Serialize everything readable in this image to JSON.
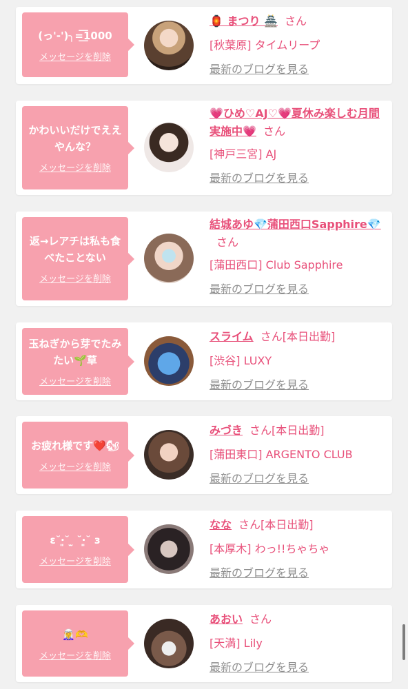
{
  "messages": [
    {
      "bubble_text": "(っ'-')╮=͟͟͞͞1000",
      "delete_label": "メッセージを削除",
      "name": "🏮 まつり 🏯",
      "san": "さん",
      "tag": "",
      "shop": "[秋葉原] タイムリープ",
      "blog_link": "最新のブログを見る"
    },
    {
      "bubble_text": "かわいいだけでええやんな？",
      "delete_label": "メッセージを削除",
      "name": "💗ひめ♡AJ♡💗夏休み楽しむ月間実施中💗",
      "san": "さん",
      "tag": "",
      "shop": "[神戸三宮] AJ",
      "blog_link": "最新のブログを見る"
    },
    {
      "bubble_text": "返→レアチは私も食べたことない",
      "delete_label": "メッセージを削除",
      "name": "結城あゆ💎蒲田西口Sapphire💎",
      "san": "さん",
      "tag": "",
      "shop": "[蒲田西口] Club Sapphire",
      "blog_link": "最新のブログを見る"
    },
    {
      "bubble_text": "玉ねぎから芽でたみたい🌱草",
      "delete_label": "メッセージを削除",
      "name": "スライム",
      "san": "さん",
      "tag": "[本日出勤]",
      "shop": "[渋谷] LUXY",
      "blog_link": "最新のブログを見る"
    },
    {
      "bubble_text": "お疲れ様です❤️🐿",
      "delete_label": "メッセージを削除",
      "name": "みづき",
      "san": "さん",
      "tag": "[本日出勤]",
      "shop": "[蒲田東口] ARGENTO CLUB",
      "blog_link": "最新のブログを見る"
    },
    {
      "bubble_text": "ε˘‧͈˘ ̫ ˘‧͈˘ з",
      "delete_label": "メッセージを削除",
      "name": "なな",
      "san": "さん",
      "tag": "[本日出勤]",
      "shop": "[本厚木] わっ!!ちゃちゃ",
      "blog_link": "最新のブログを見る"
    },
    {
      "bubble_text": "🧝‍♀️🫶",
      "delete_label": "メッセージを削除",
      "name": "あおい",
      "san": "さん",
      "tag": "",
      "shop": "[天満] Lily",
      "blog_link": "最新のブログを見る"
    }
  ],
  "colors": {
    "bubble": "#f7a1ae",
    "name_pink": "#e8507a",
    "link_gray": "#8e8e8e",
    "page_bg": "#f1f1f1"
  }
}
